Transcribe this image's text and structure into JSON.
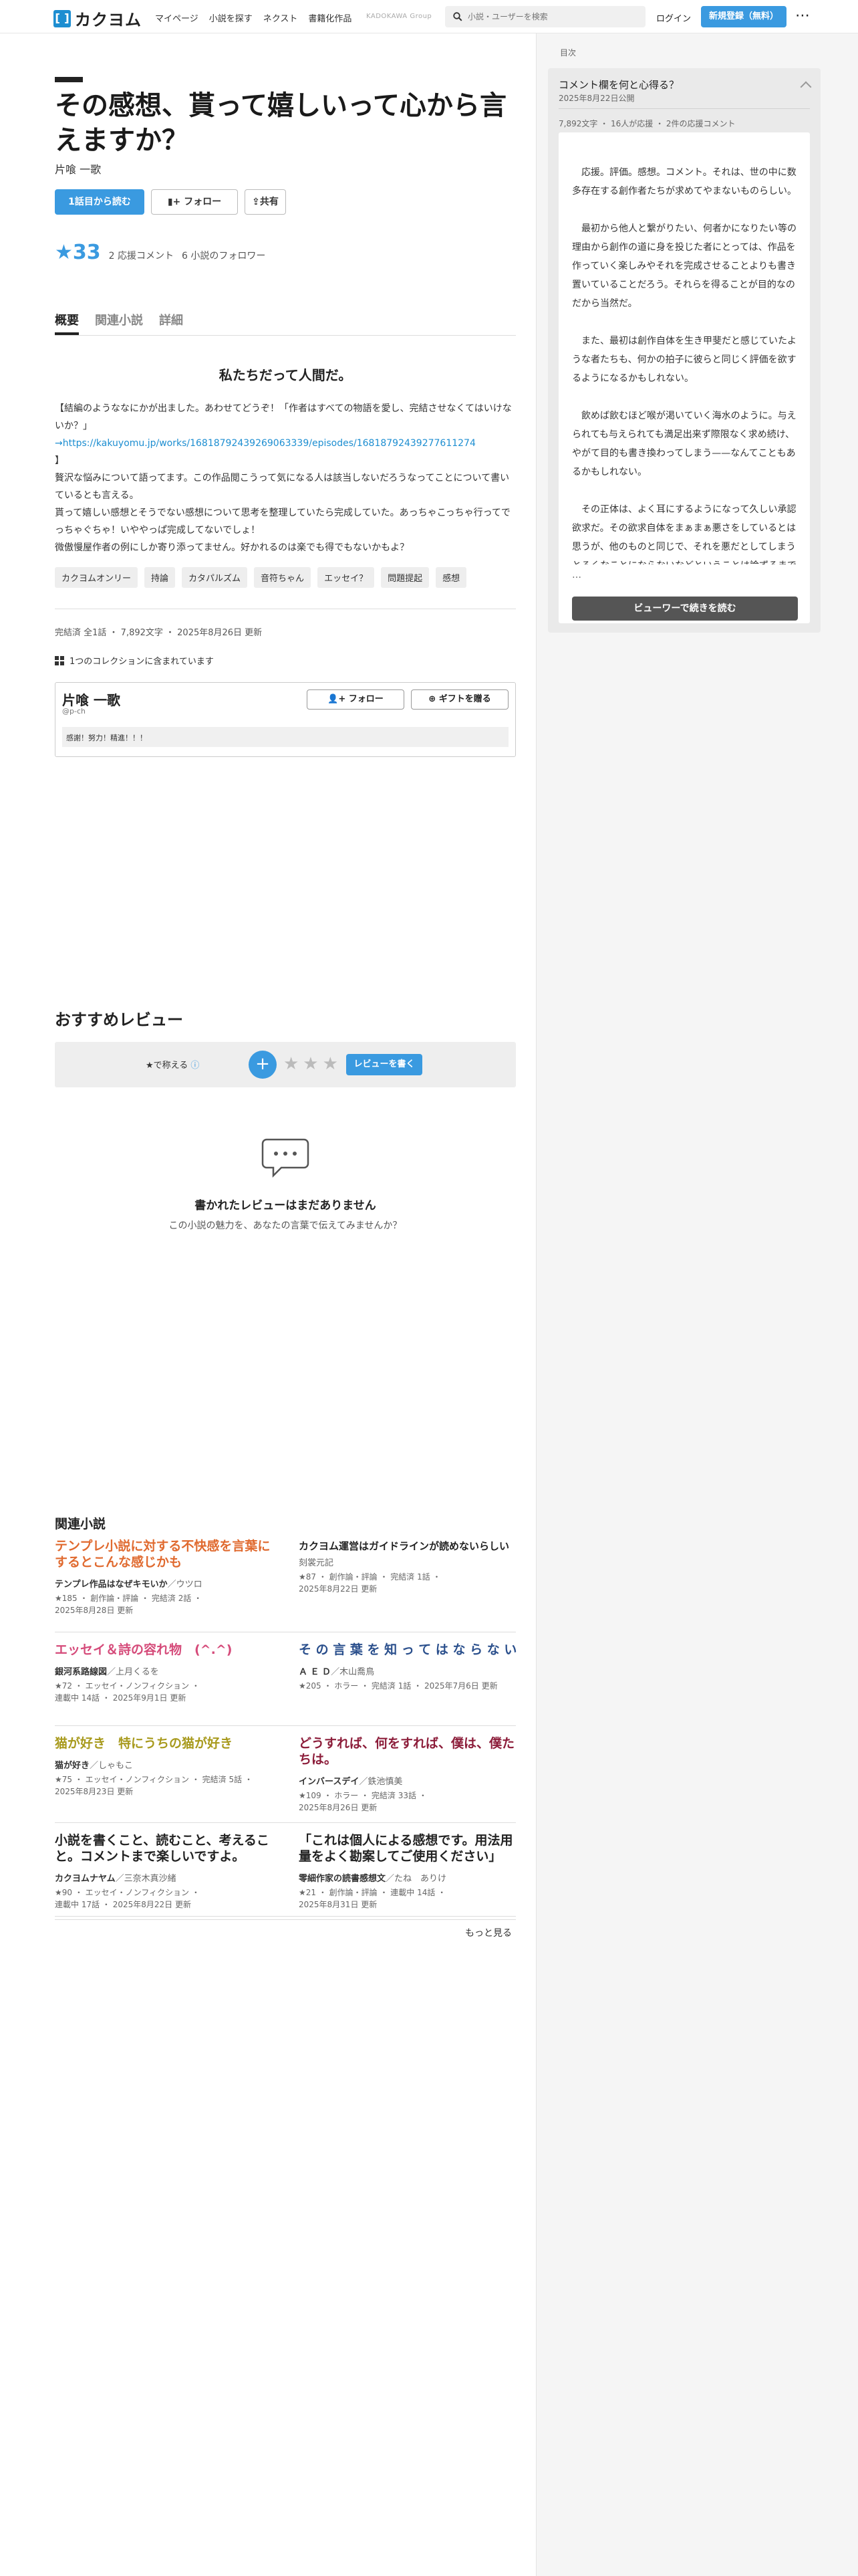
{
  "header": {
    "logo_text": "カクヨム",
    "logo_mark": "[ ]",
    "nav": [
      "マイページ",
      "小説を探す",
      "ネクスト",
      "書籍化作品"
    ],
    "brand_group": "KADOKAWA Group",
    "search_placeholder": "小説・ユーザーを検索",
    "login_label": "ログイン",
    "signup_label": "新規登録（無料）",
    "more_icon": "⋯"
  },
  "work": {
    "title": "その感想、貰って嬉しいって心から言えますか？",
    "author": "片喰 一歌",
    "read_button": "1話目から読む",
    "follow_button": "フォロー",
    "share_button": "共有",
    "star_score": "★33",
    "comments": "2 応援コメント",
    "followers": "6 小説のフォロワー"
  },
  "tabs": [
    "概要",
    "関連小説",
    "詳細"
  ],
  "overview": {
    "catch": "私たちだって人間だ。",
    "intro_1": "【結編のようななにかが出ました。あわせてどうぞ！「作者はすべての物語を愛し、完結させなくてはいけないか？」",
    "intro_link": "→https://kakuyomu.jp/works/16818792439269063339/episodes/16818792439277611274",
    "intro_2": "】",
    "intro_3": "贅沢な悩みについて語ってます。この作品閲こうって気になる人は該当しないだろうなってことについて書いているとも言える。",
    "intro_4": "貰って嬉しい感想とそうでない感想について思考を整理していたら完成していた。あっちゃこっちゃ行ってでっちゃぐちゃ！いややっぱ完成してないでしょ！",
    "intro_5": "微傲慢屋作者の例にしか寄り添ってません。好かれるのは楽でも得でもないかもよ？",
    "tags": [
      "カクヨムオンリー",
      "持論",
      "カタパルズム",
      "音符ちゃん",
      "エッセイ？",
      "問題提起",
      "感想"
    ],
    "pub_info": "完結済 全1話 ・ 7,892文字 ・ 2025年8月26日 更新",
    "collection": "1つのコレクションに含まれています"
  },
  "author_box": {
    "name": "片喰 一歌",
    "id": "@p-ch",
    "follow": "フォロー",
    "gift": "ギフトを贈る",
    "message": "感謝！努力！精進！！！"
  },
  "reviews": {
    "heading": "おすすめレビュー",
    "label": "★で称える",
    "plus": "+",
    "stars": "★★★",
    "write": "レビューを書く",
    "empty_title": "書かれたレビューはまだありません",
    "empty_sub": "この小説の魅力を、あなたの言葉で伝えてみませんか？"
  },
  "related": {
    "heading": "関連小説",
    "more": "もっと見る",
    "items": [
      {
        "title": "テンプレ小説に対する不快感を言葉にするとこんな感じかも",
        "color": "#e06a2f",
        "author_label": "テンプレ作品はなぜキモいか",
        "author": "ウツロ",
        "meta1": "★185 ・ 創作論・評論 ・ 完結済 2話 ・",
        "meta2": "2025年8月28日 更新"
      },
      {
        "title": "カクヨム運営はガイドラインが読めないらしい",
        "color": "#222",
        "author_label": "",
        "author": "刻裳元記",
        "meta1": "★87 ・ 創作論・評論 ・ 完結済 1話 ・",
        "meta2": "2025年8月22日 更新",
        "small": true
      },
      {
        "title": "エッセイ＆詩の容れ物　(^.^)",
        "color": "#d54b7a",
        "author_label": "銀河系路線図",
        "author": "上月くるを",
        "meta1": "★72 ・ エッセイ・ノンフィクション ・",
        "meta2": "連載中 14話 ・ 2025年9月1日 更新"
      },
      {
        "title": "そ の 言 葉 を 知 っ て は な ら な い",
        "color": "#2a4f8c",
        "author_label": "Ａ Ｅ Ｄ",
        "author": "木山喬鳥",
        "meta1": "★205 ・ ホラー ・ 完結済 1話 ・ 2025年7月6日 更新",
        "meta2": ""
      },
      {
        "title": "猫が好き　特にうちの猫が好き",
        "color": "#a89a1d",
        "author_label": "猫が好き",
        "author": "しゃもこ",
        "meta1": "★75 ・ エッセイ・ノンフィクション ・ 完結済 5話 ・",
        "meta2": "2025年8月23日 更新"
      },
      {
        "title": "どうすれば、何をすれば、僕は、僕たちは。",
        "color": "#8c1d3a",
        "author_label": "インバースデイ",
        "author": "鉄池慎美",
        "meta1": "★109 ・ ホラー ・ 完結済 33話 ・",
        "meta2": "2025年8月26日 更新"
      },
      {
        "title": "小説を書くこと、読むこと、考えること。コメントまで楽しいですよ。",
        "color": "#222",
        "author_label": "カクヨムナヤム",
        "author": "三奈木真沙緒",
        "meta1": "★90 ・ エッセイ・ノンフィクション ・",
        "meta2": "連載中 17話 ・ 2025年8月22日 更新"
      },
      {
        "title": "「これは個人による感想です。用法用量をよく勘案してご使用ください」",
        "color": "#222",
        "author_label": "零細作家の読書感想文",
        "author": "たね　ありけ",
        "meta1": "★21 ・ 創作論・評論 ・ 連載中 14話 ・",
        "meta2": "2025年8月31日 更新"
      }
    ]
  },
  "sidebar": {
    "toc_label": "目次",
    "episode_title": "コメント欄を何と心得る？",
    "episode_date": "2025年8月22日公開",
    "episode_meta": "7,892文字 ・ 16人が応援 ・ 2件の応援コメント",
    "preview": [
      "　応援。評価。感想。コメント。それは、世の中に数多存在する創作者たちが求めてやまないものらしい。",
      "　最初から他人と繋がりたい、何者かになりたい等の理由から創作の道に身を投じた者にとっては、作品を作っていく楽しみやそれを完成させることよりも書き置いていることだろう。それらを得ることが目的なのだから当然だ。",
      "　また、最初は創作自体を生き甲斐だと感じていたような者たちも、何かの拍子に彼らと同じく評価を欲するようになるかもしれない。",
      "　飲めば飲むほど喉が渇いていく海水のように。与えられても与えられても満足出来ず際限なく求め続け、やがて目的も書き換わってしまう——なんてこともあるかもしれない。",
      "　その正体は、よく耳にするようになって久しい承認欲求だ。その欲求自体をまぁまぁ悪さをしているとは思うが、他のものと同じで、それを悪だとしてしまうとろくなことにならないなどということは論ずるまでもないし、本題とは無関係なので省略させていただこう。"
    ],
    "ellipsis": "…",
    "viewer_button": "ビューワーで続きを読む"
  }
}
